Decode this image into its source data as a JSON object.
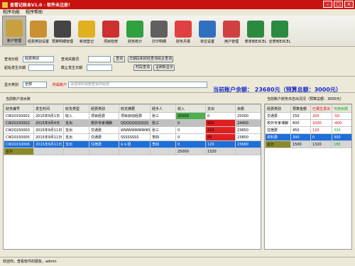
{
  "window": {
    "title": "查看记账本V1.0 - 软件未注册！"
  },
  "menu": [
    "程序功能",
    "程序帮助"
  ],
  "toolbar": [
    {
      "label": "账户管理",
      "icon": "money-bag-icon",
      "color": "#c8a040"
    },
    {
      "label": "经费类别设置",
      "icon": "coins-icon",
      "color": "#c89030"
    },
    {
      "label": "预算明细管理",
      "icon": "calculator-icon",
      "color": "#444444"
    },
    {
      "label": "新增登记",
      "icon": "pencil-icon",
      "color": "#e0b020"
    },
    {
      "label": "项目检修",
      "icon": "target-icon",
      "color": "#cc3030"
    },
    {
      "label": "财务统计",
      "icon": "pie-chart-icon",
      "color": "#30a040"
    },
    {
      "label": "打印明细",
      "icon": "printer-icon",
      "color": "#606060"
    },
    {
      "label": "财务月报",
      "icon": "calendar-icon",
      "color": "#e04040"
    },
    {
      "label": "单位设置",
      "icon": "house-icon",
      "color": "#3070c0"
    },
    {
      "label": "用户管理",
      "icon": "users-icon",
      "color": "#d04040"
    },
    {
      "label": "表单到EXCEL",
      "icon": "excel-icon",
      "color": "#2a8a40"
    },
    {
      "label": "全表到EXCEL",
      "icon": "excel-check-icon",
      "color": "#2a8a40"
    }
  ],
  "filters": {
    "query_by_label": "查询分经",
    "query_by_value": "经费类别",
    "keyword_label": "查询关键词",
    "query_btn": "查询",
    "combined_btn": "日期段和财经查询组合查询",
    "start_date_label": "起始发生日期",
    "end_date_label": "截止发生日期",
    "date_query_btn": "时段查询",
    "clear_btn": "清除查询",
    "refresh_btn": "刷新显示"
  },
  "display": {
    "category_label": "显示类别",
    "category_value": "全部",
    "account_label": "所属账户",
    "account_placeholder": "请选择所需要查看的经费",
    "balance": "当前账户余额：  23680元（预算总额：3000元）"
  },
  "left_panel": {
    "title": "当前账户流水账",
    "columns": [
      "财务编号",
      "发生时间",
      "收支类型",
      "经费类别",
      "收支摘要",
      "经手人",
      "收入",
      "支出",
      "余额"
    ],
    "rows": [
      {
        "id": "CW20150001",
        "date": "2015年9月1日",
        "type": "收入",
        "category": "项目经费",
        "summary": "项目启动经费",
        "handler": "张三",
        "income": "25000",
        "expense": "0",
        "balance": "25000",
        "style": "normal"
      },
      {
        "id": "CW20150002",
        "date": "2015年9月4日",
        "type": "支出",
        "category": "校外专家课酬",
        "summary": "QQQQQQQQQQ",
        "handler": "张三",
        "income": "0",
        "expense": "600",
        "balance": "24400",
        "style": "gray"
      },
      {
        "id": "CW20150003",
        "date": "2015年9月11日",
        "type": "支出",
        "category": "交通费",
        "summary": "WWWWWWWWW",
        "handler": "张三",
        "income": "0",
        "expense": "150",
        "balance": "23850",
        "style": "normal"
      },
      {
        "id": "CW20150005",
        "date": "2015年9月11日",
        "type": "支出",
        "category": "交通费",
        "summary": "SSSSSSSS",
        "handler": "李四",
        "income": "0",
        "expense": "50",
        "balance": "23800",
        "style": "normal"
      },
      {
        "id": "CW20150006",
        "date": "2015年9月11日",
        "type": "支出",
        "category": "住宿费",
        "summary": "$ $ 经",
        "handler": "李四",
        "income": "0",
        "expense": "120",
        "balance": "23680",
        "style": "sel"
      }
    ],
    "total": {
      "label": "合计",
      "income": "25000",
      "expense": "1320"
    }
  },
  "right_panel": {
    "title": "当前账户财务日志出况况（预算总额：3000元）",
    "columns": [
      "经费类别",
      "预算金额",
      "已报生发出",
      "可用余额"
    ],
    "rows": [
      {
        "category": "交通费",
        "budget": "150",
        "used": "200",
        "remain": "-50"
      },
      {
        "category": "校外专家课酬",
        "budget": "600",
        "used": "1000",
        "remain": "-400"
      },
      {
        "category": "住宿费",
        "budget": "450",
        "used": "120",
        "remain": "330"
      },
      {
        "category": "资料费",
        "budget": "300",
        "used": "0",
        "remain": "300"
      }
    ],
    "total": {
      "label": "合计",
      "budget": "1500",
      "used": "1320",
      "remain": "180"
    }
  },
  "status": {
    "text": "欢迎你，查看软件的朋友，admin"
  }
}
